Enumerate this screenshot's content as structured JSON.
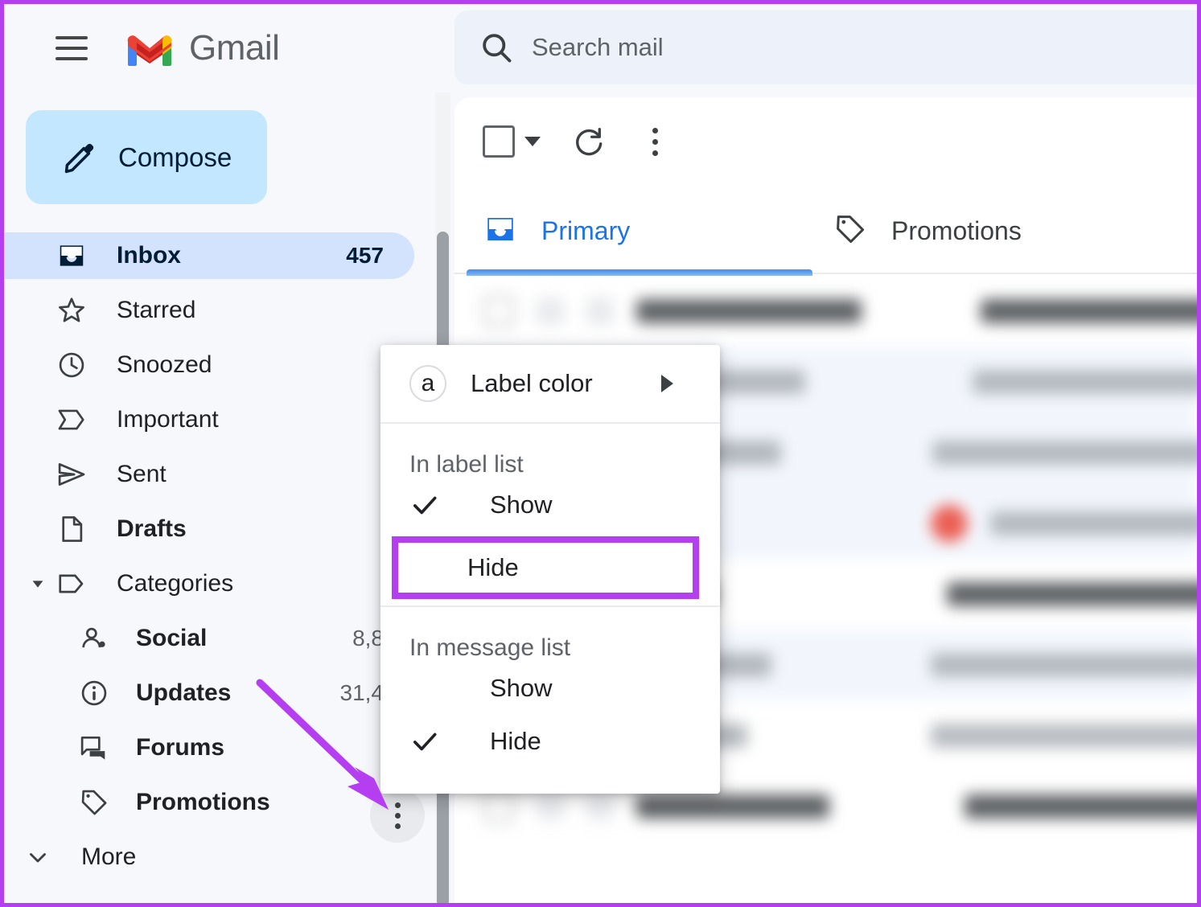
{
  "app": {
    "name": "Gmail",
    "accent_blue": "#1a73e8",
    "highlight_purple": "#b53ff0",
    "compose_bg": "#c2e7ff",
    "active_nav_bg": "#d3e3fd"
  },
  "header": {
    "menu_icon": "hamburger-icon",
    "logo_icon": "gmail-m-logo",
    "logo_text": "Gmail"
  },
  "search": {
    "icon": "search-icon",
    "placeholder": "Search mail",
    "value": ""
  },
  "sidebar": {
    "compose": {
      "label": "Compose",
      "icon": "pencil-icon"
    },
    "items": [
      {
        "label": "Inbox",
        "icon": "inbox-icon",
        "count": "457",
        "active": true,
        "bold": true
      },
      {
        "label": "Starred",
        "icon": "star-icon",
        "count": "",
        "active": false,
        "bold": false
      },
      {
        "label": "Snoozed",
        "icon": "clock-icon",
        "count": "",
        "active": false,
        "bold": false
      },
      {
        "label": "Important",
        "icon": "important-icon",
        "count": "",
        "active": false,
        "bold": false
      },
      {
        "label": "Sent",
        "icon": "send-icon",
        "count": "",
        "active": false,
        "bold": false
      },
      {
        "label": "Drafts",
        "icon": "draft-icon",
        "count": "",
        "active": false,
        "bold": true
      }
    ],
    "categories": {
      "label": "Categories",
      "icon": "label-tag-icon",
      "caret": "caret-down-icon",
      "children": [
        {
          "label": "Social",
          "icon": "people-icon",
          "count": "8,8"
        },
        {
          "label": "Updates",
          "icon": "info-icon",
          "count": "31,4"
        },
        {
          "label": "Forums",
          "icon": "forum-icon",
          "count": ""
        },
        {
          "label": "Promotions",
          "icon": "price-tag-icon",
          "count": ""
        }
      ]
    },
    "more": {
      "label": "More",
      "icon": "chevron-down-icon"
    },
    "overflow_button": {
      "icon": "more-vertical-icon"
    }
  },
  "toolbar": {
    "select_all": {
      "icon": "checkbox-icon",
      "caret": "caret-down-icon"
    },
    "refresh": {
      "icon": "refresh-icon"
    },
    "more": {
      "icon": "more-vertical-icon"
    }
  },
  "tabs": [
    {
      "label": "Primary",
      "icon": "inbox-icon",
      "active": true
    },
    {
      "label": "Promotions",
      "icon": "price-tag-icon",
      "active": false
    }
  ],
  "context_menu": {
    "label_color": {
      "label": "Label color",
      "badge": "a",
      "submenu_arrow": "caret-right-icon"
    },
    "sections": [
      {
        "title": "In label list",
        "options": [
          {
            "label": "Show",
            "checked": true,
            "highlighted": false
          },
          {
            "label": "Hide",
            "checked": false,
            "highlighted": true
          }
        ]
      },
      {
        "title": "In message list",
        "options": [
          {
            "label": "Show",
            "checked": false,
            "highlighted": false
          },
          {
            "label": "Hide",
            "checked": true,
            "highlighted": false
          }
        ]
      }
    ]
  },
  "annotation": {
    "arrow": {
      "color": "#b53ff0",
      "points_to": "sidebar-overflow-button"
    },
    "box": {
      "color": "#b53ff0",
      "around": "menu-option-hide-in-label-list"
    }
  },
  "mail_list": {
    "blurred": true,
    "rows": [
      {
        "state": "unread",
        "sender_w": 280,
        "subject_w": 430,
        "badge": false,
        "dot": false,
        "subject_light": false
      },
      {
        "state": "read",
        "sender_w": 210,
        "subject_w": 470,
        "badge": false,
        "dot": false,
        "subject_light": true
      },
      {
        "state": "read",
        "sender_w": 250,
        "subject_w": 450,
        "badge": true,
        "dot": false,
        "subject_light": true
      },
      {
        "state": "read",
        "sender_w": 190,
        "subject_w": 300,
        "badge": false,
        "dot": true,
        "subject_light": true
      },
      {
        "state": "unread",
        "sender_w": 160,
        "subject_w": 400,
        "badge": false,
        "dot": false,
        "subject_light": false
      },
      {
        "state": "read",
        "sender_w": 230,
        "subject_w": 420,
        "badge": false,
        "dot": false,
        "subject_light": true
      },
      {
        "state": "unread",
        "sender_w": 200,
        "subject_w": 380,
        "badge": false,
        "dot": false,
        "subject_light": true
      },
      {
        "state": "unread",
        "sender_w": 240,
        "subject_w": 410,
        "badge": false,
        "dot": false,
        "subject_light": false
      }
    ]
  }
}
